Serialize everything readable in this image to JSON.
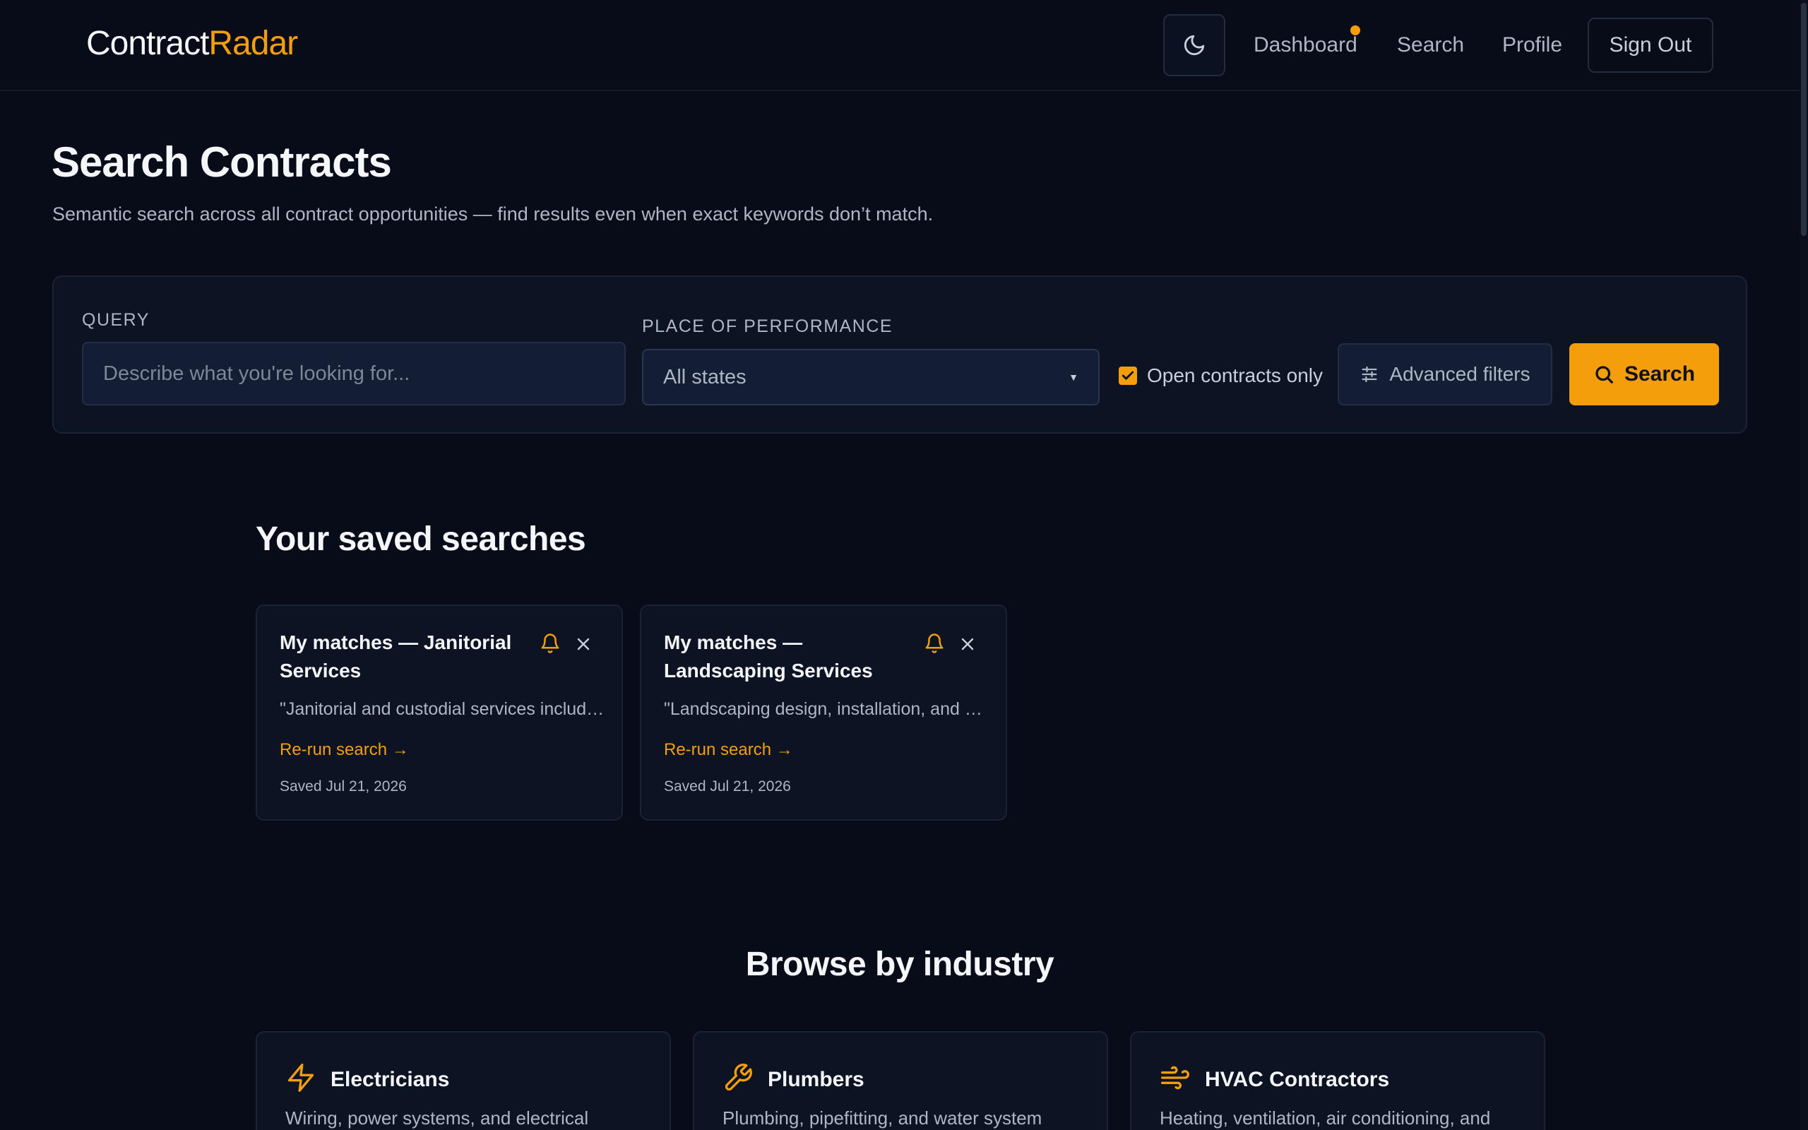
{
  "header": {
    "logo_part1": "Contract",
    "logo_part2": "Radar",
    "nav": {
      "dashboard": "Dashboard",
      "search": "Search",
      "profile": "Profile",
      "sign_out": "Sign Out"
    },
    "icons": {
      "theme_toggle": "moon-icon"
    }
  },
  "page": {
    "title": "Search Contracts",
    "subtitle": "Semantic search across all contract opportunities — find results even when exact keywords don’t match."
  },
  "search_panel": {
    "query_label": "QUERY",
    "query_placeholder": "Describe what you're looking for...",
    "query_value": "",
    "place_label": "PLACE OF PERFORMANCE",
    "place_selected": "All states",
    "open_only_label": "Open contracts only",
    "open_only_checked": true,
    "advanced_label": "Advanced filters",
    "search_label": "Search"
  },
  "saved": {
    "title": "Your saved searches",
    "items": [
      {
        "name": "My matches — Janitorial Services",
        "snippet": "\"Janitorial and custodial services including",
        "rerun": "Re-run search →",
        "date": "Saved Jul 21, 2026"
      },
      {
        "name": "My matches — Landscaping Services",
        "snippet": "\"Landscaping design, installation, and maintenance",
        "rerun": "Re-run search →",
        "date": "Saved Jul 21, 2026"
      }
    ]
  },
  "browse": {
    "title": "Browse by industry",
    "items": [
      {
        "name": "Electricians",
        "desc": "Wiring, power systems, and electrical",
        "icon": "lightning-icon"
      },
      {
        "name": "Plumbers",
        "desc": "Plumbing, pipefitting, and water system",
        "icon": "wrench-icon"
      },
      {
        "name": "HVAC Contractors",
        "desc": "Heating, ventilation, air conditioning, and",
        "icon": "wind-icon"
      }
    ]
  },
  "colors": {
    "background": "#070c18",
    "accent": "#f59e0b",
    "card": "#0c1322"
  }
}
